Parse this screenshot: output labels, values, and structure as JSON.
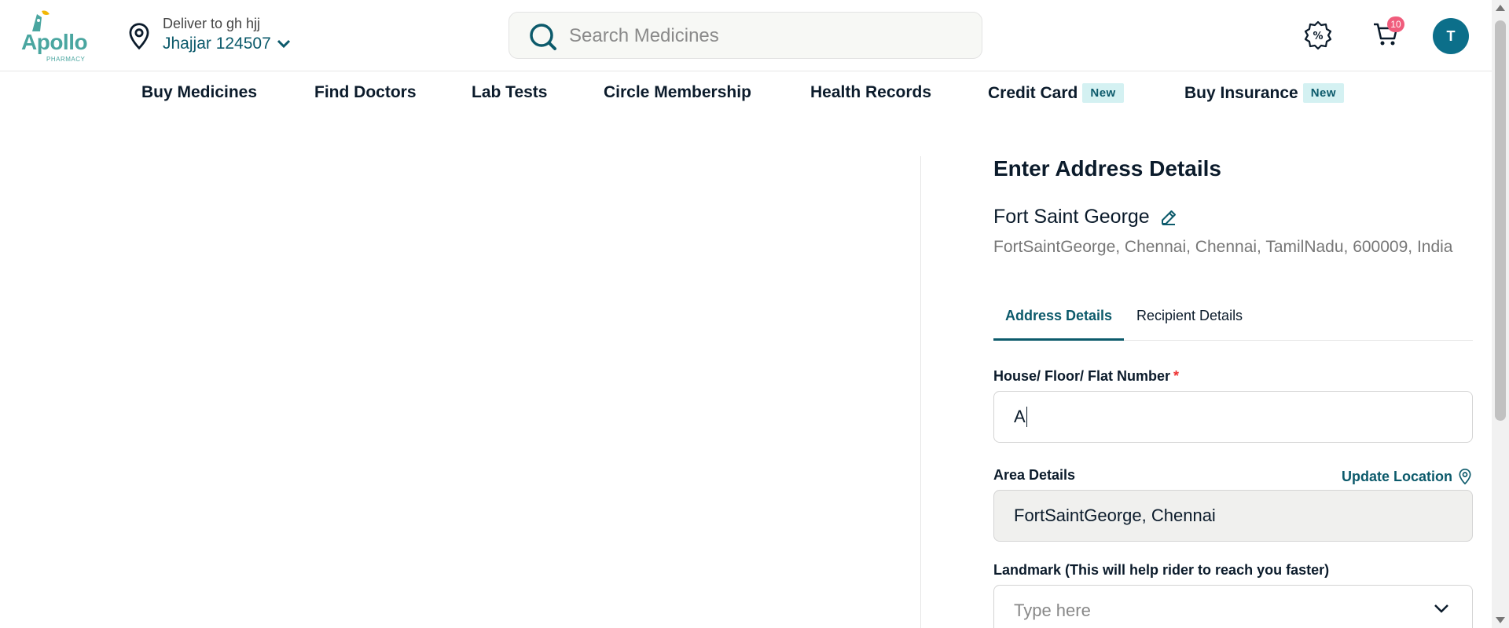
{
  "header": {
    "logo_text": "Apollo",
    "logo_sub": "PHARMACY",
    "deliver_label": "Deliver to gh hjj",
    "deliver_location": "Jhajjar 124507",
    "search_placeholder": "Search Medicines",
    "cart_count": "10",
    "avatar_initial": "T"
  },
  "nav": {
    "items": [
      {
        "label": "Buy Medicines"
      },
      {
        "label": "Find Doctors"
      },
      {
        "label": "Lab Tests"
      },
      {
        "label": "Circle Membership"
      },
      {
        "label": "Health Records"
      },
      {
        "label": "Credit Card",
        "badge": "New"
      },
      {
        "label": "Buy Insurance",
        "badge": "New"
      }
    ]
  },
  "panel": {
    "title": "Enter Address Details",
    "location_name": "Fort Saint George",
    "location_address": "FortSaintGeorge, Chennai, Chennai, TamilNadu, 600009, India",
    "tabs": [
      {
        "label": "Address Details",
        "active": true
      },
      {
        "label": "Recipient Details",
        "active": false
      }
    ],
    "house_label": "House/ Floor/ Flat Number",
    "house_required": "*",
    "house_value": "A",
    "area_label": "Area Details",
    "update_location": "Update Location",
    "area_value": "FortSaintGeorge, Chennai",
    "landmark_label": "Landmark (This will help rider to reach you faster)",
    "landmark_placeholder": "Type here"
  },
  "colors": {
    "brand_teal": "#0c5a6b",
    "logo_green": "#4aa6a0",
    "badge_bg": "#d4f1f2",
    "cart_badge": "#f05c7c",
    "avatar_bg": "#0c6f8a"
  },
  "icons": [
    "location-pin-icon",
    "chevron-down-icon",
    "search-icon",
    "offer-icon",
    "cart-icon",
    "edit-icon",
    "update-location-pin-icon"
  ]
}
